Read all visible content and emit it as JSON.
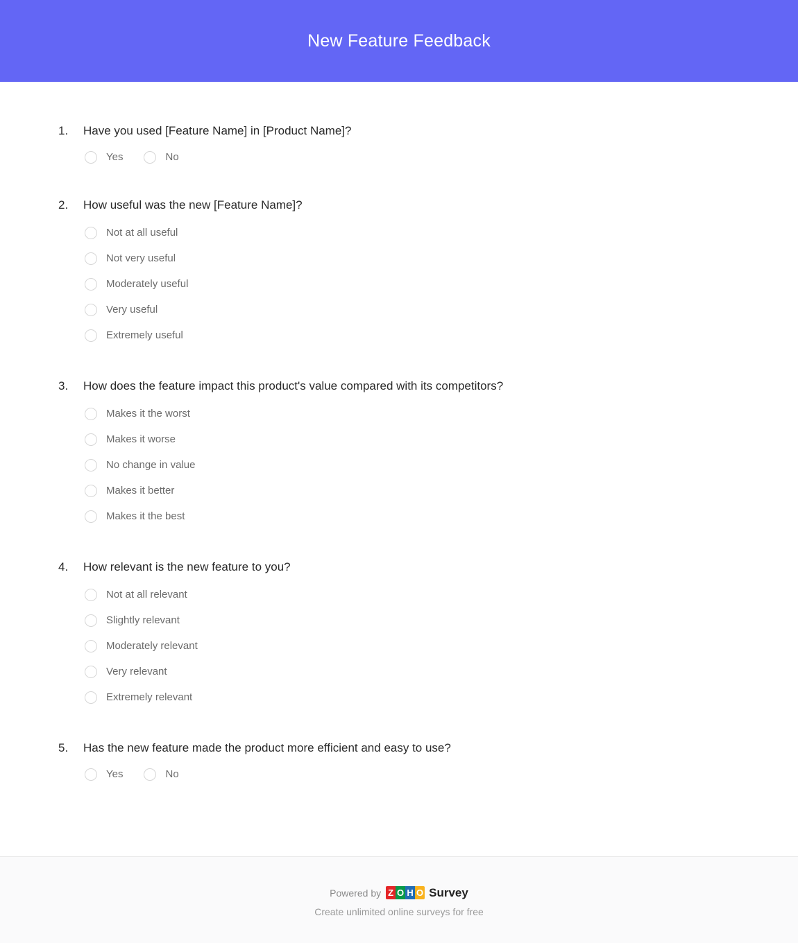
{
  "header": {
    "title": "New Feature Feedback",
    "background_color": "#6366F5",
    "text_color": "#FFFFFF"
  },
  "survey": {
    "questions": [
      {
        "number": "1.",
        "text": "Have you used [Feature Name] in [Product Name]?",
        "layout": "inline",
        "options": [
          "Yes",
          "No"
        ]
      },
      {
        "number": "2.",
        "text": "How useful was the new [Feature Name]?",
        "layout": "stacked",
        "options": [
          "Not at all useful",
          "Not very useful",
          "Moderately useful",
          "Very useful",
          "Extremely useful"
        ]
      },
      {
        "number": "3.",
        "text": "How does the feature impact this product's value compared with its competitors?",
        "layout": "stacked",
        "options": [
          "Makes it the worst",
          "Makes it worse",
          "No change in value",
          "Makes it better",
          "Makes it the best"
        ]
      },
      {
        "number": "4.",
        "text": "How relevant is the new feature to you?",
        "layout": "stacked",
        "options": [
          "Not at all relevant",
          "Slightly relevant",
          "Moderately relevant",
          "Very relevant",
          "Extremely relevant"
        ]
      },
      {
        "number": "5.",
        "text": "Has the new feature made the product more efficient and easy to use?",
        "layout": "inline",
        "options": [
          "Yes",
          "No"
        ]
      }
    ]
  },
  "footer": {
    "powered_by": "Powered by",
    "brand_letters": [
      "Z",
      "O",
      "H",
      "O"
    ],
    "brand_colors": [
      "#E42527",
      "#089949",
      "#226DB4",
      "#F9B21D"
    ],
    "product_word": "Survey",
    "tagline": "Create unlimited online surveys for free"
  }
}
